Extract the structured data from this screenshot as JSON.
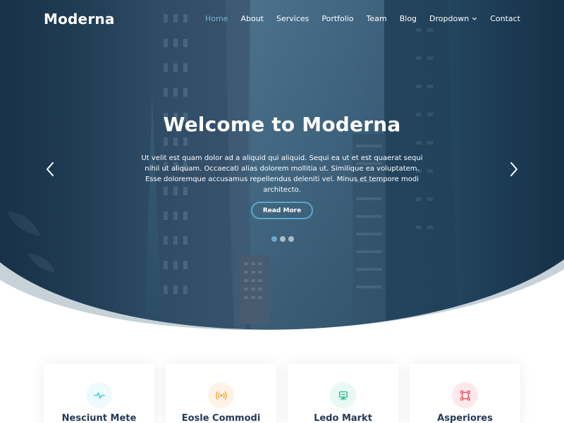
{
  "header": {
    "logo": "Moderna",
    "nav": {
      "home": "Home",
      "about": "About",
      "services": "Services",
      "portfolio": "Portfolio",
      "team": "Team",
      "blog": "Blog",
      "dropdown": "Dropdown",
      "contact": "Contact"
    }
  },
  "hero": {
    "title": "Welcome to Moderna",
    "text": "Ut velit est quam dolor ad a aliquid qui aliquid. Sequi ea ut et est quaerat sequi nihil ut aliquam. Occaecati alias dolorem mollitia ut. Similique ea voluptatem. Esse doloremque accusamus repellendus deleniti vel. Minus et tempore modi architecto.",
    "cta": "Read More",
    "carousel_count": 3,
    "active_slide": 1
  },
  "services": {
    "items": [
      {
        "title": "Nesciunt Mete",
        "icon": "activity-icon",
        "accent": "#2fc6e5",
        "background": "#eefbfe"
      },
      {
        "title": "Eosle Commodi",
        "icon": "broadcast-icon",
        "accent": "#f39c27",
        "background": "#fff3e7"
      },
      {
        "title": "Ledo Markt",
        "icon": "easel-icon",
        "accent": "#1fbc8a",
        "background": "#e9f9f4"
      },
      {
        "title": "Asperiores",
        "icon": "bounding-box-icon",
        "accent": "#ef4a5b",
        "background": "#fde9ec"
      }
    ]
  },
  "colors": {
    "hero_overlay": "#1d3f56",
    "accent": "#5aa8cc",
    "wave": "#c6d1d8",
    "heading": "#243b55"
  }
}
